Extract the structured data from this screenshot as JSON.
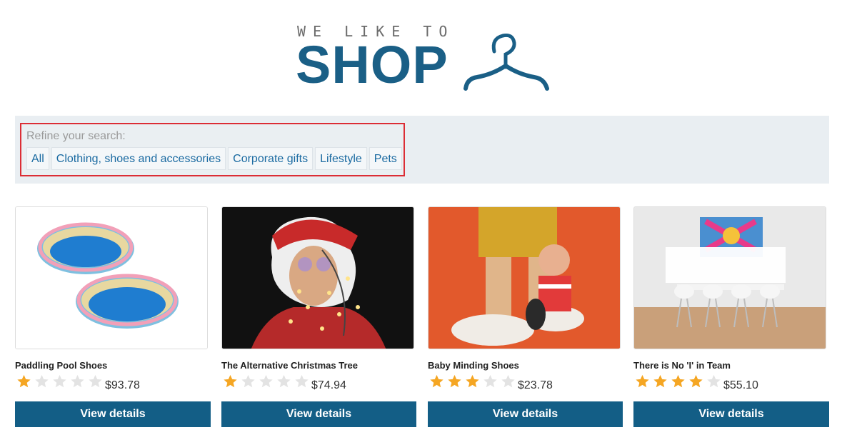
{
  "logo": {
    "top_text": "WE LIKE TO",
    "main_text": "SHOP"
  },
  "filters": {
    "label": "Refine your search:",
    "items": [
      {
        "label": "All"
      },
      {
        "label": "Clothing, shoes and accessories"
      },
      {
        "label": "Corporate gifts"
      },
      {
        "label": "Lifestyle"
      },
      {
        "label": "Pets"
      }
    ]
  },
  "products": [
    {
      "title": "Paddling Pool Shoes",
      "rating": 1,
      "price": "$93.78",
      "button": "View details"
    },
    {
      "title": "The Alternative Christmas Tree",
      "rating": 1,
      "price": "$74.94",
      "button": "View details"
    },
    {
      "title": "Baby Minding Shoes",
      "rating": 3,
      "price": "$23.78",
      "button": "View details"
    },
    {
      "title": "There is No 'I' in Team",
      "rating": 4,
      "price": "$55.10",
      "button": "View details"
    }
  ],
  "colors": {
    "brand": "#1a5f86",
    "button": "#135e86",
    "highlight": "#dc2d35",
    "star_on": "#f5a623",
    "star_off": "#e3e3e3"
  }
}
